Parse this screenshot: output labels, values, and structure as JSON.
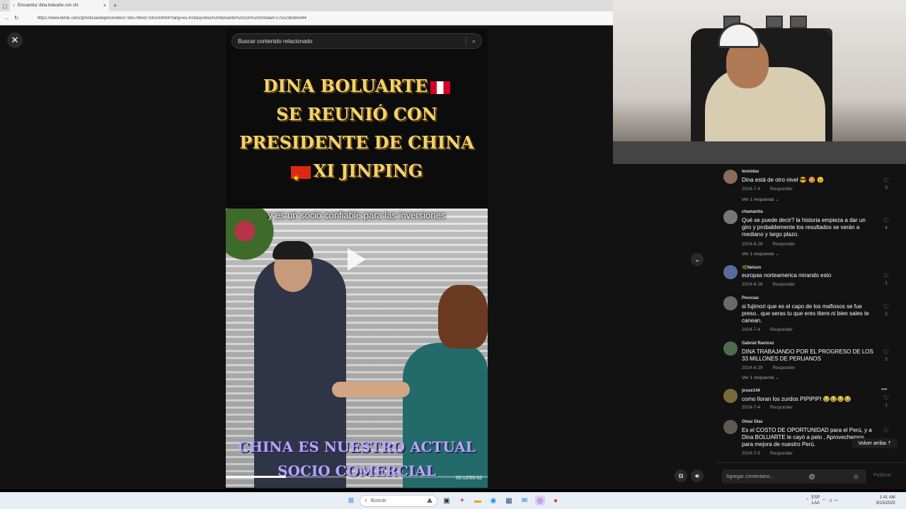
{
  "browser": {
    "tab_title": "Encuentra 'dina boluarte con chi",
    "url": "https://www.tiktok.com/@noticiasdeperu/video/7385786597330169094?lang=es-419&q=dina%20boluarte%20con%20china&t=1755236385444"
  },
  "tiktok": {
    "search_placeholder": "Buscar contenido relacionado",
    "video": {
      "title_lines": [
        "DINA BOLUARTE",
        "SE REUNIÓ CON",
        "PRESIDENTE DE CHINA",
        "XI JINPING"
      ],
      "subtitle_top": "y es un socio confiable para las inversiones",
      "subtitle_bottom": "CHINA ES NUESTRO ACTUAL SOCIO COMERCIAL",
      "time": "00:12/00:52",
      "progress_fraction": 0.23
    },
    "comments": [
      {
        "user": "leonidas",
        "text": "Dina está de otro nivel 😎 🤩 😉",
        "date": "2024-7-4",
        "reply_label": "Responder",
        "likes": "3",
        "replies": "Ver 1 respuesta ⌄"
      },
      {
        "user": "chamanita",
        "text": "Qué se puede decir? la historia empieza a dar un giro y probablemente los resultados se verán a mediano y largo plazo.",
        "date": "2024-6-28",
        "reply_label": "Responder",
        "likes": "4",
        "replies": "Ver 1 respuesta ⌄"
      },
      {
        "user": "🌿Nelson",
        "text": "europas norteamerica mirando esto",
        "date": "2024-6-28",
        "reply_label": "Responder",
        "likes": "1",
        "replies": ""
      },
      {
        "user": "Pecosac",
        "text": "si fujimori que es el capo de los mafiosos se fue preso.. que seras tu que eres titere.ni bien sales te canean.",
        "date": "2024-7-4",
        "reply_label": "Responder",
        "likes": "2",
        "replies": ""
      },
      {
        "user": "Gabriel Ramirez",
        "text": "DINA TRABAJANDO POR EL PROGRESO DE LOS 33 MILLONES DE PERUANOS",
        "date": "2024-6-29",
        "reply_label": "Responder",
        "likes": "2",
        "replies": "Ver 1 respuesta ⌄"
      },
      {
        "user": "josue144",
        "text": "como lloran los zurdos PIPIPIPI 😂😂😂😂",
        "date": "2024-7-4",
        "reply_label": "Responder",
        "likes": "1",
        "replies": ""
      },
      {
        "user": "Omar Diaz",
        "text": "Es el COSTO DE OPORTUNIDAD para el Perú, y a Dina BOLUARTE le cayó a pelo , Aprovechemos para mejora de nuestro Perú.",
        "date": "2024-7-5",
        "reply_label": "Responder",
        "likes": "",
        "replies": ""
      }
    ],
    "volver_arriba": "Volver arriba",
    "comment_placeholder": "Agregar comentario...",
    "publish_label": "Publicar"
  },
  "taskbar": {
    "search_label": "Buscar",
    "lang_line1": "ESP",
    "lang_line2": "LAA",
    "time": "1:41 AM",
    "date": "8/15/2025"
  }
}
